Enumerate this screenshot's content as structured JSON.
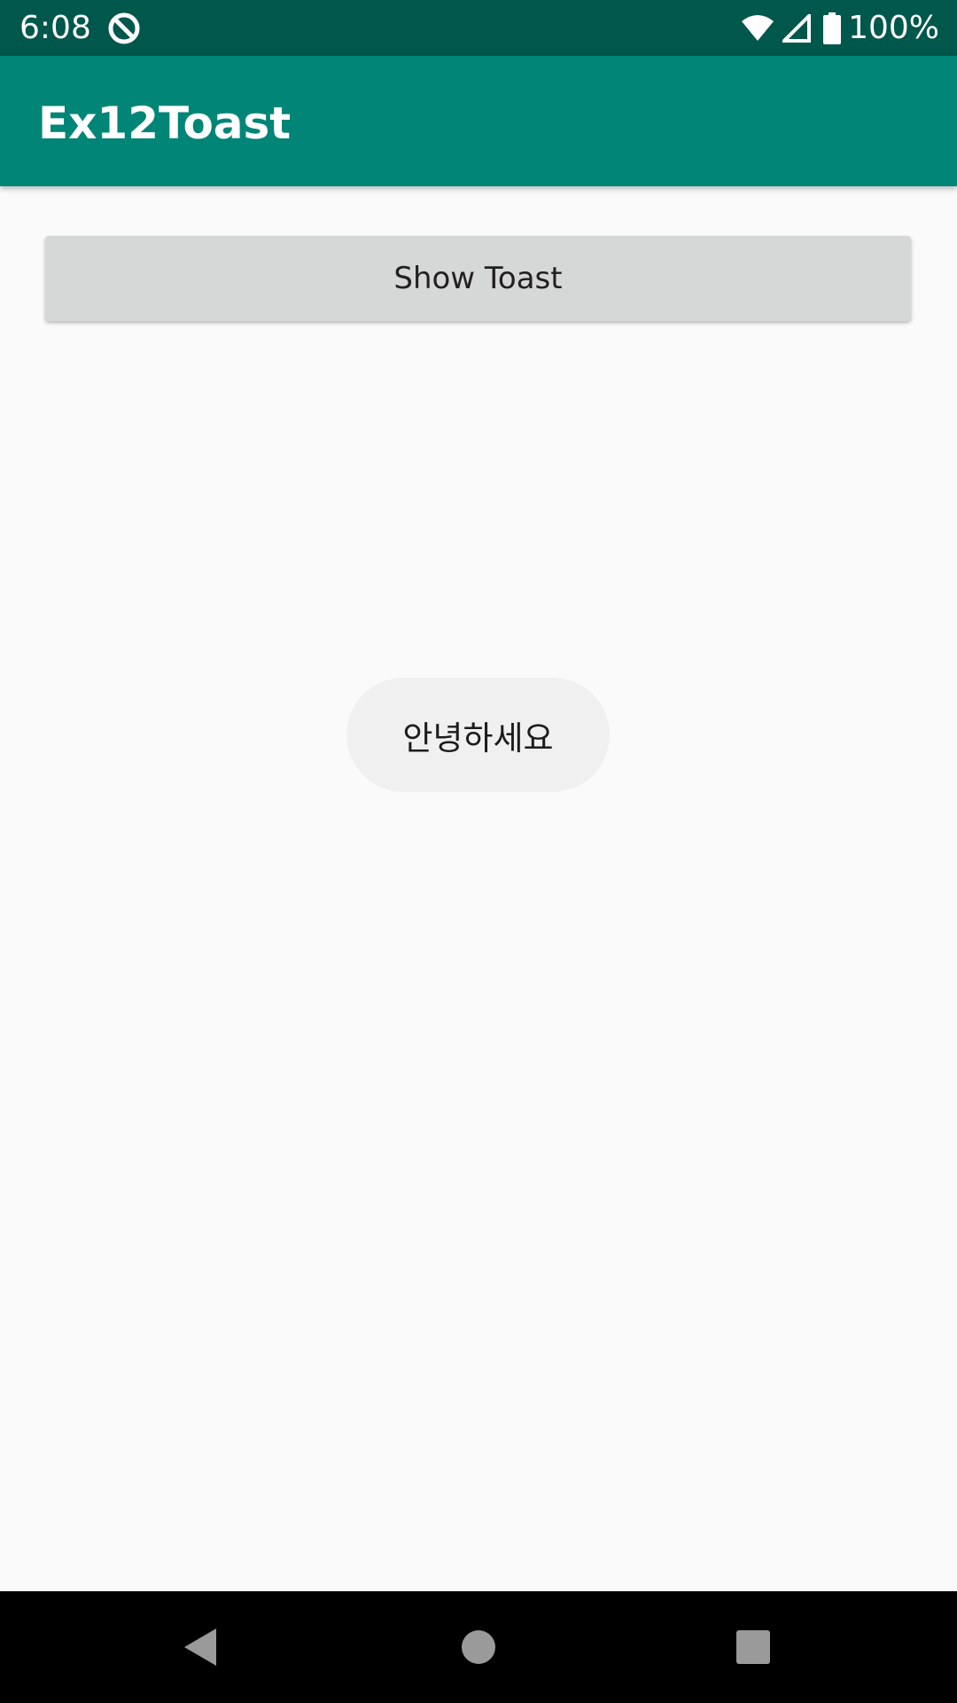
{
  "status_bar": {
    "time": "6:08",
    "battery": "100%",
    "icons": [
      "app-notification-icon",
      "wifi-icon",
      "cell-signal-icon",
      "battery-icon"
    ]
  },
  "app_bar": {
    "title": "Ex12Toast",
    "color": "#008577"
  },
  "main": {
    "show_toast_label": "Show Toast"
  },
  "toast": {
    "message": "안녕하세요"
  },
  "nav_bar": {
    "icons": [
      "back-icon",
      "home-icon",
      "recents-icon"
    ]
  },
  "colors": {
    "status_bar": "#00574b",
    "app_bar": "#008577",
    "background": "#fafafa",
    "button": "#d6d7d7",
    "toast": "#f0f0f0"
  }
}
